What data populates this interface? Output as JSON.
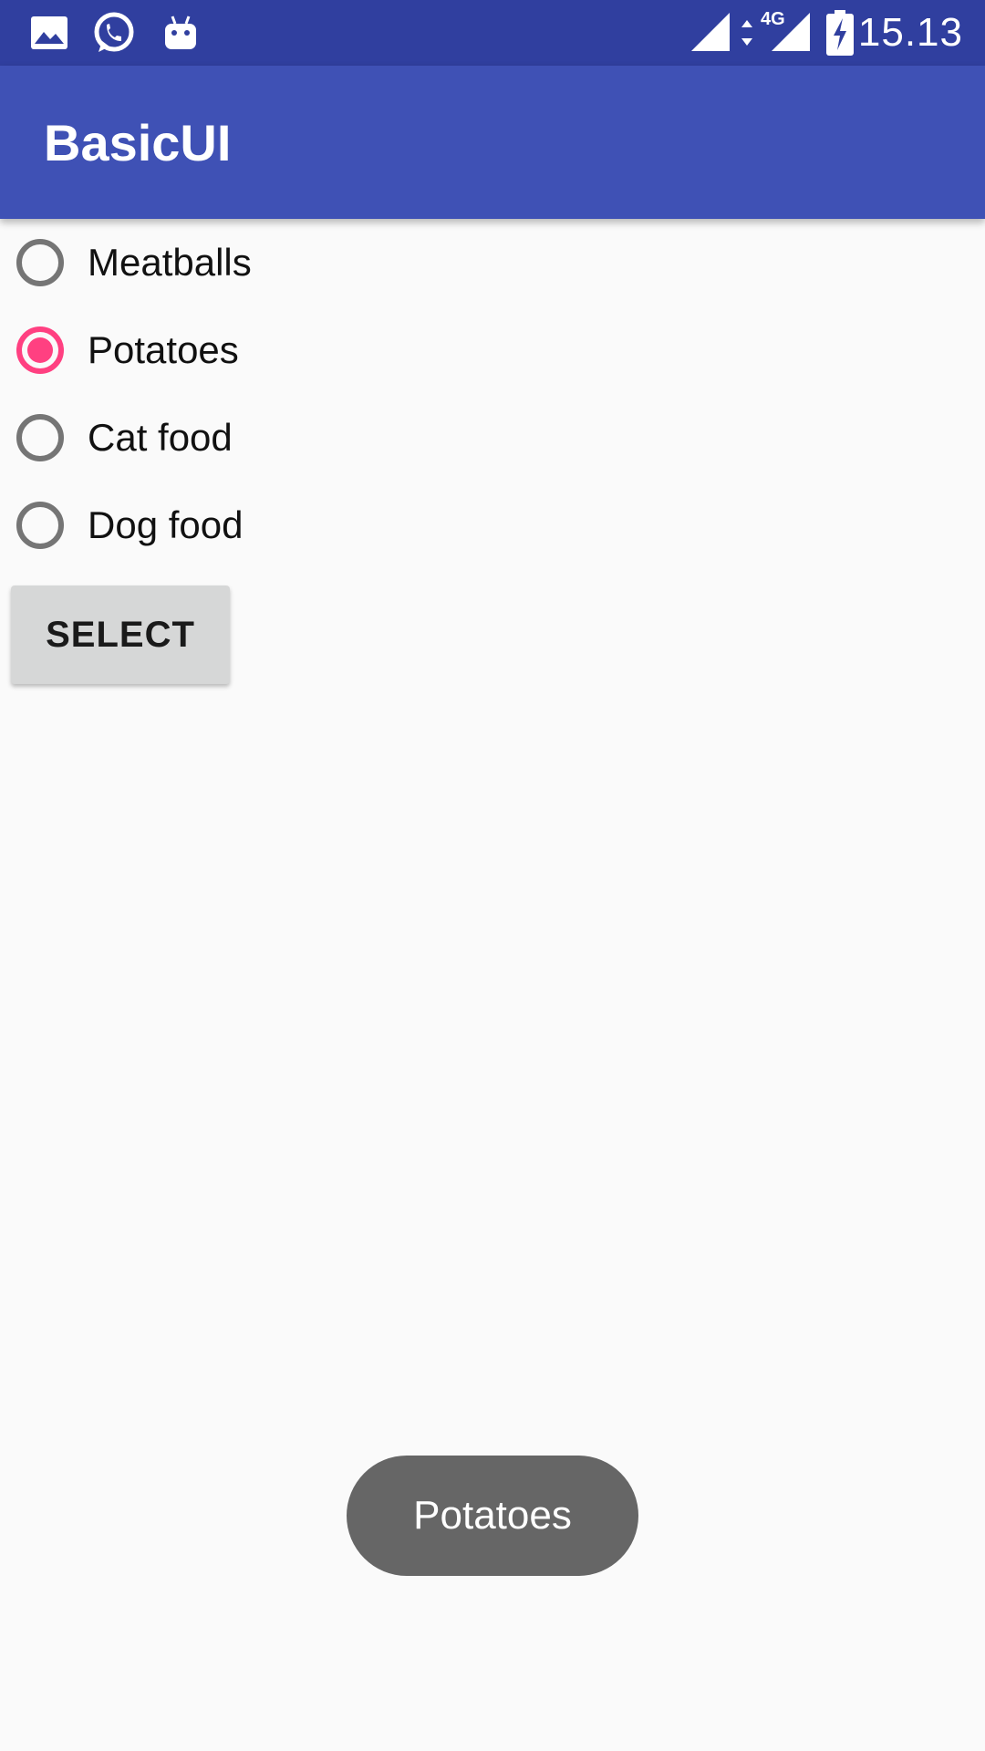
{
  "status_bar": {
    "time": "15.13",
    "network_label": "4G",
    "left_icons": [
      "gallery-icon",
      "whatsapp-icon",
      "android-icon"
    ],
    "right_icons": [
      "signal-icon",
      "data-arrows-icon",
      "signal-4g-icon",
      "battery-charging-icon"
    ]
  },
  "app_bar": {
    "title": "BasicUI"
  },
  "radio_group": {
    "options": [
      {
        "label": "Meatballs",
        "checked": false
      },
      {
        "label": "Potatoes",
        "checked": true
      },
      {
        "label": "Cat food",
        "checked": false
      },
      {
        "label": "Dog food",
        "checked": false
      }
    ]
  },
  "select_button": {
    "label": "SELECT"
  },
  "toast": {
    "message": "Potatoes"
  },
  "colors": {
    "status_bar": "#303f9f",
    "app_bar": "#3f51b5",
    "accent": "#ff4081",
    "background": "#fafafa",
    "button": "#d6d7d7",
    "toast": "#666666"
  }
}
